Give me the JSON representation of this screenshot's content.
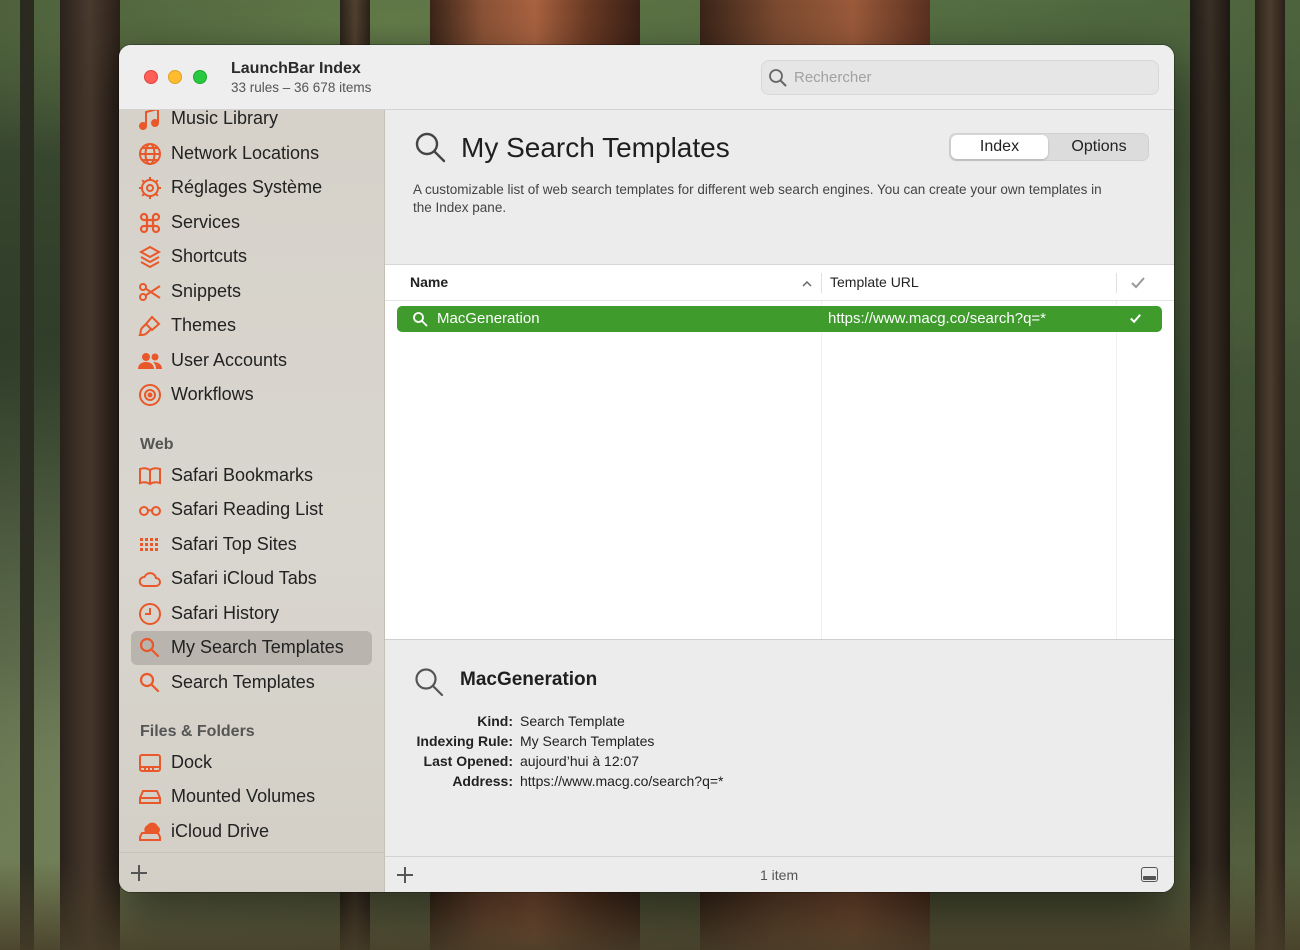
{
  "window": {
    "title": "LaunchBar Index",
    "subtitle": "33 rules – 36 678 items",
    "search_placeholder": "Rechercher"
  },
  "colors": {
    "accent_orange": "#e8582a",
    "selection_green": "#3e9b2c"
  },
  "sidebar": {
    "items_top": [
      {
        "label": "Music Library",
        "icon": "music-notes-icon"
      },
      {
        "label": "Network Locations",
        "icon": "globe-icon"
      },
      {
        "label": "Réglages Système",
        "icon": "gear-icon"
      },
      {
        "label": "Services",
        "icon": "command-icon"
      },
      {
        "label": "Shortcuts",
        "icon": "shortcuts-icon"
      },
      {
        "label": "Snippets",
        "icon": "scissors-icon"
      },
      {
        "label": "Themes",
        "icon": "paintbrush-icon"
      },
      {
        "label": "User Accounts",
        "icon": "users-icon"
      },
      {
        "label": "Workflows",
        "icon": "automator-icon"
      }
    ],
    "section_web": "Web",
    "items_web": [
      {
        "label": "Safari Bookmarks",
        "icon": "book-icon"
      },
      {
        "label": "Safari Reading List",
        "icon": "glasses-icon"
      },
      {
        "label": "Safari Top Sites",
        "icon": "grid-icon"
      },
      {
        "label": "Safari iCloud Tabs",
        "icon": "cloud-icon"
      },
      {
        "label": "Safari History",
        "icon": "clock-icon"
      },
      {
        "label": "My Search Templates",
        "icon": "magnifier-icon",
        "active": true
      },
      {
        "label": "Search Templates",
        "icon": "magnifier-icon"
      }
    ],
    "section_files": "Files & Folders",
    "items_files": [
      {
        "label": "Dock",
        "icon": "dock-icon"
      },
      {
        "label": "Mounted Volumes",
        "icon": "drive-icon"
      },
      {
        "label": "iCloud Drive",
        "icon": "icloud-drive-icon"
      }
    ]
  },
  "main": {
    "title": "My Search Templates",
    "tabs": [
      "Index",
      "Options"
    ],
    "selected_tab": "Index",
    "description": "A customizable list of web search templates for different web search engines. You can create your own templates in the Index pane.",
    "table": {
      "columns": [
        "Name",
        "Template URL"
      ],
      "sort_column": "Name",
      "sort_direction": "ascending",
      "rows": [
        {
          "name": "MacGeneration",
          "url": "https://www.macg.co/search?q=*",
          "enabled": true,
          "selected": true
        }
      ]
    },
    "detail": {
      "title": "MacGeneration",
      "fields": [
        {
          "key": "Kind:",
          "value": "Search Template"
        },
        {
          "key": "Indexing Rule:",
          "value": "My Search Templates"
        },
        {
          "key": "Last Opened:",
          "value": "aujourd’hui à 12:07"
        },
        {
          "key": "Address:",
          "value": "https://www.macg.co/search?q=*"
        }
      ]
    },
    "footer_count": "1 item"
  }
}
